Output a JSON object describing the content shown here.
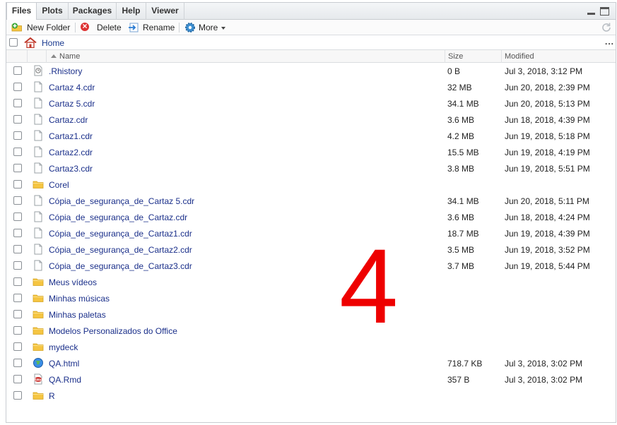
{
  "tabs": [
    {
      "label": "Files",
      "active": true
    },
    {
      "label": "Plots",
      "active": false
    },
    {
      "label": "Packages",
      "active": false
    },
    {
      "label": "Help",
      "active": false
    },
    {
      "label": "Viewer",
      "active": false
    }
  ],
  "toolbar": {
    "new_folder": "New Folder",
    "delete": "Delete",
    "rename": "Rename",
    "more": "More"
  },
  "breadcrumb": {
    "home": "Home",
    "more": "..."
  },
  "columns": {
    "name": "Name",
    "size": "Size",
    "modified": "Modified"
  },
  "files": [
    {
      "icon": "rhistory-icon",
      "name": ".Rhistory",
      "size": "0 B",
      "modified": "Jul 3, 2018, 3:12 PM"
    },
    {
      "icon": "file-icon",
      "name": "Cartaz 4.cdr",
      "size": "32 MB",
      "modified": "Jun 20, 2018, 2:39 PM"
    },
    {
      "icon": "file-icon",
      "name": "Cartaz 5.cdr",
      "size": "34.1 MB",
      "modified": "Jun 20, 2018, 5:13 PM"
    },
    {
      "icon": "file-icon",
      "name": "Cartaz.cdr",
      "size": "3.6 MB",
      "modified": "Jun 18, 2018, 4:39 PM"
    },
    {
      "icon": "file-icon",
      "name": "Cartaz1.cdr",
      "size": "4.2 MB",
      "modified": "Jun 19, 2018, 5:18 PM"
    },
    {
      "icon": "file-icon",
      "name": "Cartaz2.cdr",
      "size": "15.5 MB",
      "modified": "Jun 19, 2018, 4:19 PM"
    },
    {
      "icon": "file-icon",
      "name": "Cartaz3.cdr",
      "size": "3.8 MB",
      "modified": "Jun 19, 2018, 5:51 PM"
    },
    {
      "icon": "folder-icon",
      "name": "Corel",
      "size": "",
      "modified": ""
    },
    {
      "icon": "file-icon",
      "name": "Cópia_de_segurança_de_Cartaz 5.cdr",
      "size": "34.1 MB",
      "modified": "Jun 20, 2018, 5:11 PM"
    },
    {
      "icon": "file-icon",
      "name": "Cópia_de_segurança_de_Cartaz.cdr",
      "size": "3.6 MB",
      "modified": "Jun 18, 2018, 4:24 PM"
    },
    {
      "icon": "file-icon",
      "name": "Cópia_de_segurança_de_Cartaz1.cdr",
      "size": "18.7 MB",
      "modified": "Jun 19, 2018, 4:39 PM"
    },
    {
      "icon": "file-icon",
      "name": "Cópia_de_segurança_de_Cartaz2.cdr",
      "size": "3.5 MB",
      "modified": "Jun 19, 2018, 3:52 PM"
    },
    {
      "icon": "file-icon",
      "name": "Cópia_de_segurança_de_Cartaz3.cdr",
      "size": "3.7 MB",
      "modified": "Jun 19, 2018, 5:44 PM"
    },
    {
      "icon": "folder-icon",
      "name": "Meus vídeos",
      "size": "",
      "modified": ""
    },
    {
      "icon": "folder-icon",
      "name": "Minhas músicas",
      "size": "",
      "modified": ""
    },
    {
      "icon": "folder-icon",
      "name": "Minhas paletas",
      "size": "",
      "modified": ""
    },
    {
      "icon": "folder-icon",
      "name": "Modelos Personalizados do Office",
      "size": "",
      "modified": ""
    },
    {
      "icon": "folder-icon",
      "name": "mydeck",
      "size": "",
      "modified": ""
    },
    {
      "icon": "html-icon",
      "name": "QA.html",
      "size": "718.7 KB",
      "modified": "Jul 3, 2018, 3:02 PM"
    },
    {
      "icon": "rmd-icon",
      "name": "QA.Rmd",
      "size": "357 B",
      "modified": "Jul 3, 2018, 3:02 PM"
    },
    {
      "icon": "folder-icon",
      "name": "R",
      "size": "",
      "modified": ""
    }
  ],
  "overlay_number": "4",
  "colors": {
    "link": "#1a2f8a",
    "overlay": "#ee0000",
    "folder": "#f5c542"
  }
}
